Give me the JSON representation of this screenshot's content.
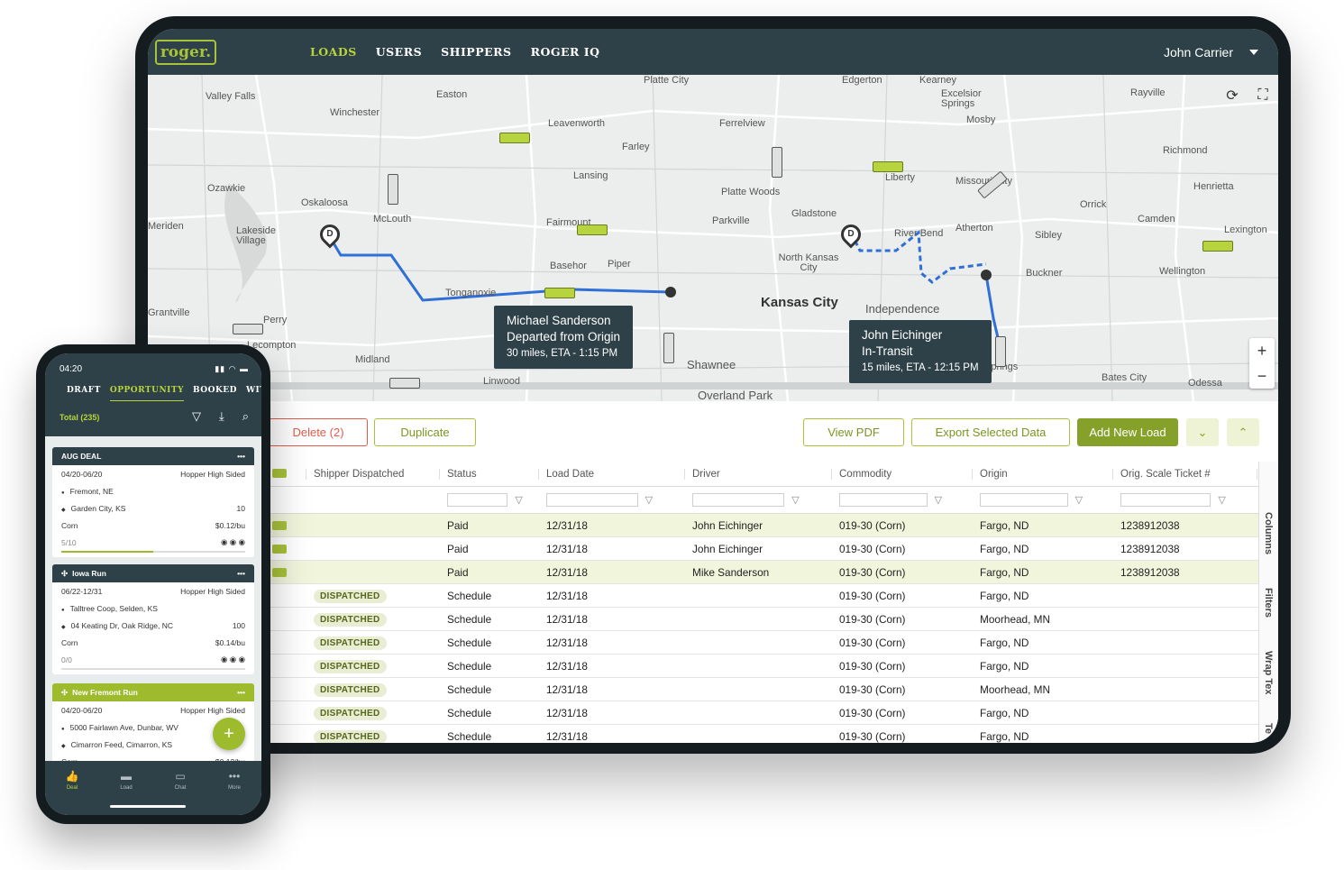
{
  "app": {
    "logo_text": "roger."
  },
  "nav": {
    "items": [
      "LOADS",
      "USERS",
      "SHIPPERS",
      "ROGER IQ"
    ],
    "active": "LOADS"
  },
  "user": {
    "name": "John Carrier"
  },
  "map": {
    "labels": [
      "Valley Falls",
      "Easton",
      "Winchester",
      "Leavenworth",
      "Farley",
      "Ferrelview",
      "Excelsior Springs",
      "Rayville",
      "Mosby",
      "Richmond",
      "Ozawkie",
      "Oskaloosa",
      "Lansing",
      "Platte Woods",
      "Liberty",
      "Missouri City",
      "Henrietta",
      "Meriden",
      "Lakeside Village",
      "McLouth",
      "Fairmount",
      "Parkville",
      "Gladstone",
      "Orrick",
      "Camden",
      "River Bend",
      "Atherton",
      "Sibley",
      "Lexington",
      "Basehor",
      "Piper",
      "North Kansas City",
      "Buckner",
      "Wellington",
      "Tonganoxie",
      "Independence",
      "Grantville",
      "Perry",
      "Lecompton",
      "Midland",
      "Linwood",
      "Shawnee",
      "Overland Park",
      "Bates City",
      "Odessa",
      "Springs",
      "Kearney",
      "Edgerton",
      "Platte City"
    ],
    "city_label": "Kansas City",
    "tooltips": [
      {
        "name": "Michael Sanderson",
        "status": "Departed from Origin",
        "eta": "30 miles, ETA - 1:15 PM"
      },
      {
        "name": "John Eichinger",
        "status": "In-Transit",
        "eta": "15 miles, ETA - 12:15 PM"
      }
    ],
    "pin_letter": "D",
    "zoom_in": "+",
    "zoom_out": "−"
  },
  "toolbar": {
    "delete": "Delete (2)",
    "duplicate": "Duplicate",
    "view_pdf": "View PDF",
    "export": "Export Selected Data",
    "add_load": "Add New Load"
  },
  "table": {
    "columns": [
      "Shipper Dispatched",
      "Status",
      "Load Date",
      "Driver",
      "Commodity",
      "Origin",
      "Orig. Scale Ticket #"
    ],
    "rows": [
      {
        "dispatched": "",
        "status": "Paid",
        "date": "12/31/18",
        "driver": "John Eichinger",
        "commodity": "019-30 (Corn)",
        "origin": "Fargo, ND",
        "ticket": "1238912038"
      },
      {
        "dispatched": "",
        "status": "Paid",
        "date": "12/31/18",
        "driver": "John Eichinger",
        "commodity": "019-30 (Corn)",
        "origin": "Fargo, ND",
        "ticket": "1238912038"
      },
      {
        "dispatched": "",
        "status": "Paid",
        "date": "12/31/18",
        "driver": "Mike Sanderson",
        "commodity": "019-30 (Corn)",
        "origin": "Fargo, ND",
        "ticket": "1238912038"
      },
      {
        "dispatched": "DISPATCHED",
        "status": "Schedule",
        "date": "12/31/18",
        "driver": "",
        "commodity": "019-30 (Corn)",
        "origin": "Fargo, ND",
        "ticket": ""
      },
      {
        "dispatched": "DISPATCHED",
        "status": "Schedule",
        "date": "12/31/18",
        "driver": "",
        "commodity": "019-30 (Corn)",
        "origin": "Moorhead, MN",
        "ticket": ""
      },
      {
        "dispatched": "DISPATCHED",
        "status": "Schedule",
        "date": "12/31/18",
        "driver": "",
        "commodity": "019-30 (Corn)",
        "origin": "Fargo, ND",
        "ticket": ""
      },
      {
        "dispatched": "DISPATCHED",
        "status": "Schedule",
        "date": "12/31/18",
        "driver": "",
        "commodity": "019-30 (Corn)",
        "origin": "Fargo, ND",
        "ticket": ""
      },
      {
        "dispatched": "DISPATCHED",
        "status": "Schedule",
        "date": "12/31/18",
        "driver": "",
        "commodity": "019-30 (Corn)",
        "origin": "Moorhead, MN",
        "ticket": ""
      },
      {
        "dispatched": "DISPATCHED",
        "status": "Schedule",
        "date": "12/31/18",
        "driver": "",
        "commodity": "019-30 (Corn)",
        "origin": "Fargo, ND",
        "ticket": ""
      },
      {
        "dispatched": "DISPATCHED",
        "status": "Schedule",
        "date": "12/31/18",
        "driver": "",
        "commodity": "019-30 (Corn)",
        "origin": "Fargo, ND",
        "ticket": ""
      }
    ]
  },
  "side_panel": {
    "tabs": [
      "Columns",
      "Filters",
      "Wrap Tex",
      "Wrap Te"
    ]
  },
  "phone": {
    "time": "04:20",
    "tabs": [
      "DRAFT",
      "OPPORTUNITY",
      "BOOKED",
      "WIT"
    ],
    "active_tab": "OPPORTUNITY",
    "total": "Total (235)",
    "cards": [
      {
        "title": "AUG DEAL",
        "dates": "04/20-06/20",
        "trailer": "Hopper High Sided",
        "from": "Fremont, NE",
        "to": "Garden City, KS",
        "qty": "10",
        "commodity": "Corn",
        "rate": "$0.12/bu",
        "progress": "5/10",
        "progress_fraction": 0.5
      },
      {
        "title": "Iowa Run",
        "dates": "06/22-12/31",
        "trailer": "Hopper High Sided",
        "from": "Talltree Coop, Selden, KS",
        "to": "04 Keating Dr, Oak Ridge, NC",
        "qty": "100",
        "commodity": "Corn",
        "rate": "$0.14/bu",
        "progress": "0/0",
        "progress_fraction": 0
      },
      {
        "title": "New Fremont Run",
        "dates": "04/20-06/20",
        "trailer": "Hopper High Sided",
        "from": "5000 Fairlawn Ave, Dunbar, WV",
        "to": "Cimarron Feed, Cimarron, KS",
        "qty": "",
        "commodity": "Corn",
        "rate": "$0.12/bu",
        "progress": "",
        "progress_fraction": 0
      }
    ],
    "more": "•••",
    "fab": "+",
    "bottom_nav": [
      {
        "label": "Deal",
        "icon": "thumbs-up"
      },
      {
        "label": "Load",
        "icon": "truck"
      },
      {
        "label": "Chat",
        "icon": "chat"
      },
      {
        "label": "More",
        "icon": "more"
      }
    ]
  },
  "colors": {
    "nav_bg": "#2e4149",
    "accent": "#b7d33d",
    "danger": "#e25b4a"
  }
}
